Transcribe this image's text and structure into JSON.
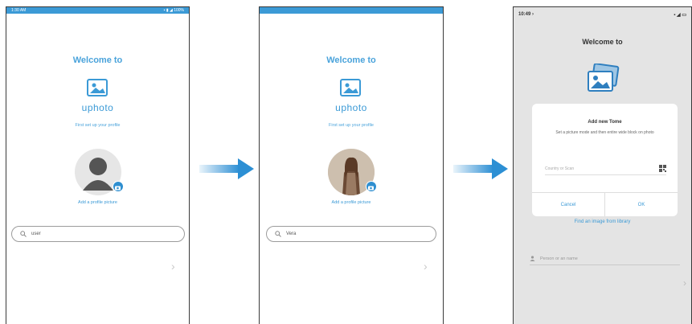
{
  "screens": [
    {
      "status_time": "1:30 AM",
      "status_icons": "▪ ▮ ◢ 100%",
      "title": "Welcome to",
      "brand": "uphoto",
      "prompt": "First set up your profile",
      "add_photo": "Add a profile picture",
      "name_value": "user",
      "next_glyph": "›"
    },
    {
      "title": "Welcome to",
      "brand": "uphoto",
      "prompt": "First set up your profile",
      "add_photo": "Add a profile picture",
      "name_value": "Vera",
      "next_glyph": "›"
    },
    {
      "status_time": "10:49 ›",
      "status_icons": "▪ ◢ ▭",
      "title": "Welcome to",
      "dialog": {
        "title": "Add new Tome",
        "message": "Set a picture mode and then entire wide block on photo",
        "input_placeholder": "Country or Scan",
        "cancel_label": "Cancel",
        "ok_label": "OK"
      },
      "link": "Find an image from library",
      "field_placeholder": "Person or an name",
      "next_glyph": "›"
    }
  ],
  "colors": {
    "accent": "#3b9ad6",
    "arrow": "#2c8fd4"
  },
  "icons": {
    "photo_logo": "photo-gallery-icon",
    "camera": "camera-icon",
    "search": "search-icon",
    "next": "chevron-right-icon",
    "qr": "qr-code-icon"
  }
}
